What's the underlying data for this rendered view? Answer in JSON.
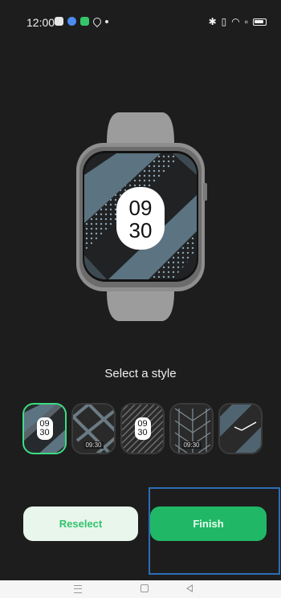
{
  "status_bar": {
    "time": "12:00",
    "notification_icons": [
      "app-icon",
      "browser-icon",
      "green-app-icon",
      "location-icon",
      "dot-icon"
    ],
    "system_icons": [
      "bluetooth-icon",
      "vibrate-icon",
      "wifi-icon",
      "nfc-icon",
      "battery-icon"
    ]
  },
  "preview": {
    "time_hour": "09",
    "time_minute": "30"
  },
  "title": "Select a style",
  "styles": [
    {
      "id": "stripes-diagonal",
      "label_top": "09",
      "label_bottom": "30",
      "selected": true
    },
    {
      "id": "lattice",
      "bottom_label": "09:30",
      "selected": false
    },
    {
      "id": "stripes-dense",
      "label_top": "09",
      "label_bottom": "30",
      "selected": false
    },
    {
      "id": "weave",
      "bottom_label": "09:30",
      "selected": false
    },
    {
      "id": "analog",
      "selected": false
    }
  ],
  "buttons": {
    "reselect": "Reselect",
    "finish": "Finish"
  },
  "colors": {
    "background": "#1d1d1d",
    "accent_green": "#20b866",
    "reselect_bg": "#e8f6ec",
    "highlight": "#2e6db6"
  }
}
